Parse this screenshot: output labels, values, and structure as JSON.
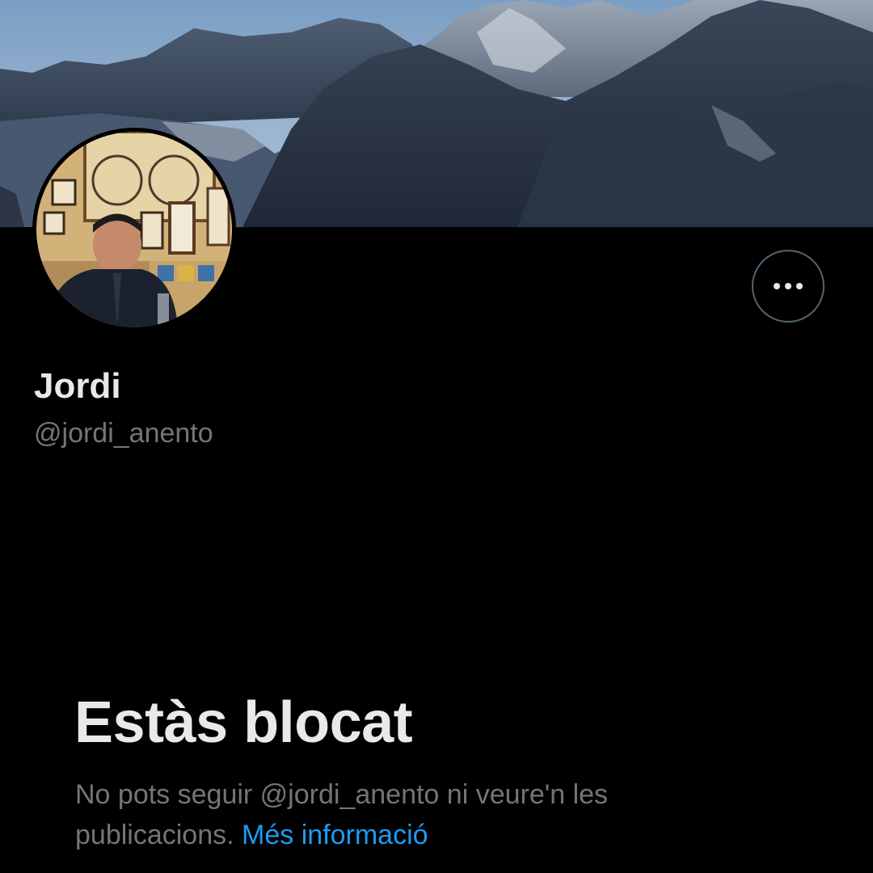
{
  "profile": {
    "display_name": "Jordi",
    "handle": "@jordi_anento"
  },
  "actions": {
    "more_icon": "more-horizontal-icon"
  },
  "blocked": {
    "title": "Estàs blocat",
    "message_part1": "No pots seguir @jordi_anento ni veure'n les publicacions.",
    "learn_more_link": "Més informació"
  },
  "colors": {
    "background": "#000000",
    "primary_text": "#e7e9ea",
    "secondary_text": "#71767b",
    "link": "#1d9bf0",
    "button_border": "#536471"
  }
}
